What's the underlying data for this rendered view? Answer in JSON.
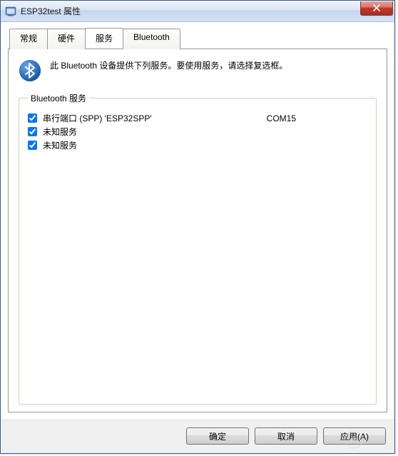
{
  "window": {
    "title": "ESP32test 属性"
  },
  "tabs": [
    {
      "label": "常规"
    },
    {
      "label": "硬件"
    },
    {
      "label": "服务"
    },
    {
      "label": "Bluetooth"
    }
  ],
  "active_tab_index": 2,
  "intro": "此 Bluetooth 设备提供下列服务。要使用服务，请选择复选框。",
  "groupbox_title": "Bluetooth 服务",
  "services": [
    {
      "checked": true,
      "label": "串行端口 (SPP) 'ESP32SPP'",
      "port": "COM15"
    },
    {
      "checked": true,
      "label": "未知服务",
      "port": ""
    },
    {
      "checked": true,
      "label": "未知服务",
      "port": ""
    }
  ],
  "buttons": {
    "ok": "确定",
    "cancel": "取消",
    "apply": "应用(A)"
  }
}
